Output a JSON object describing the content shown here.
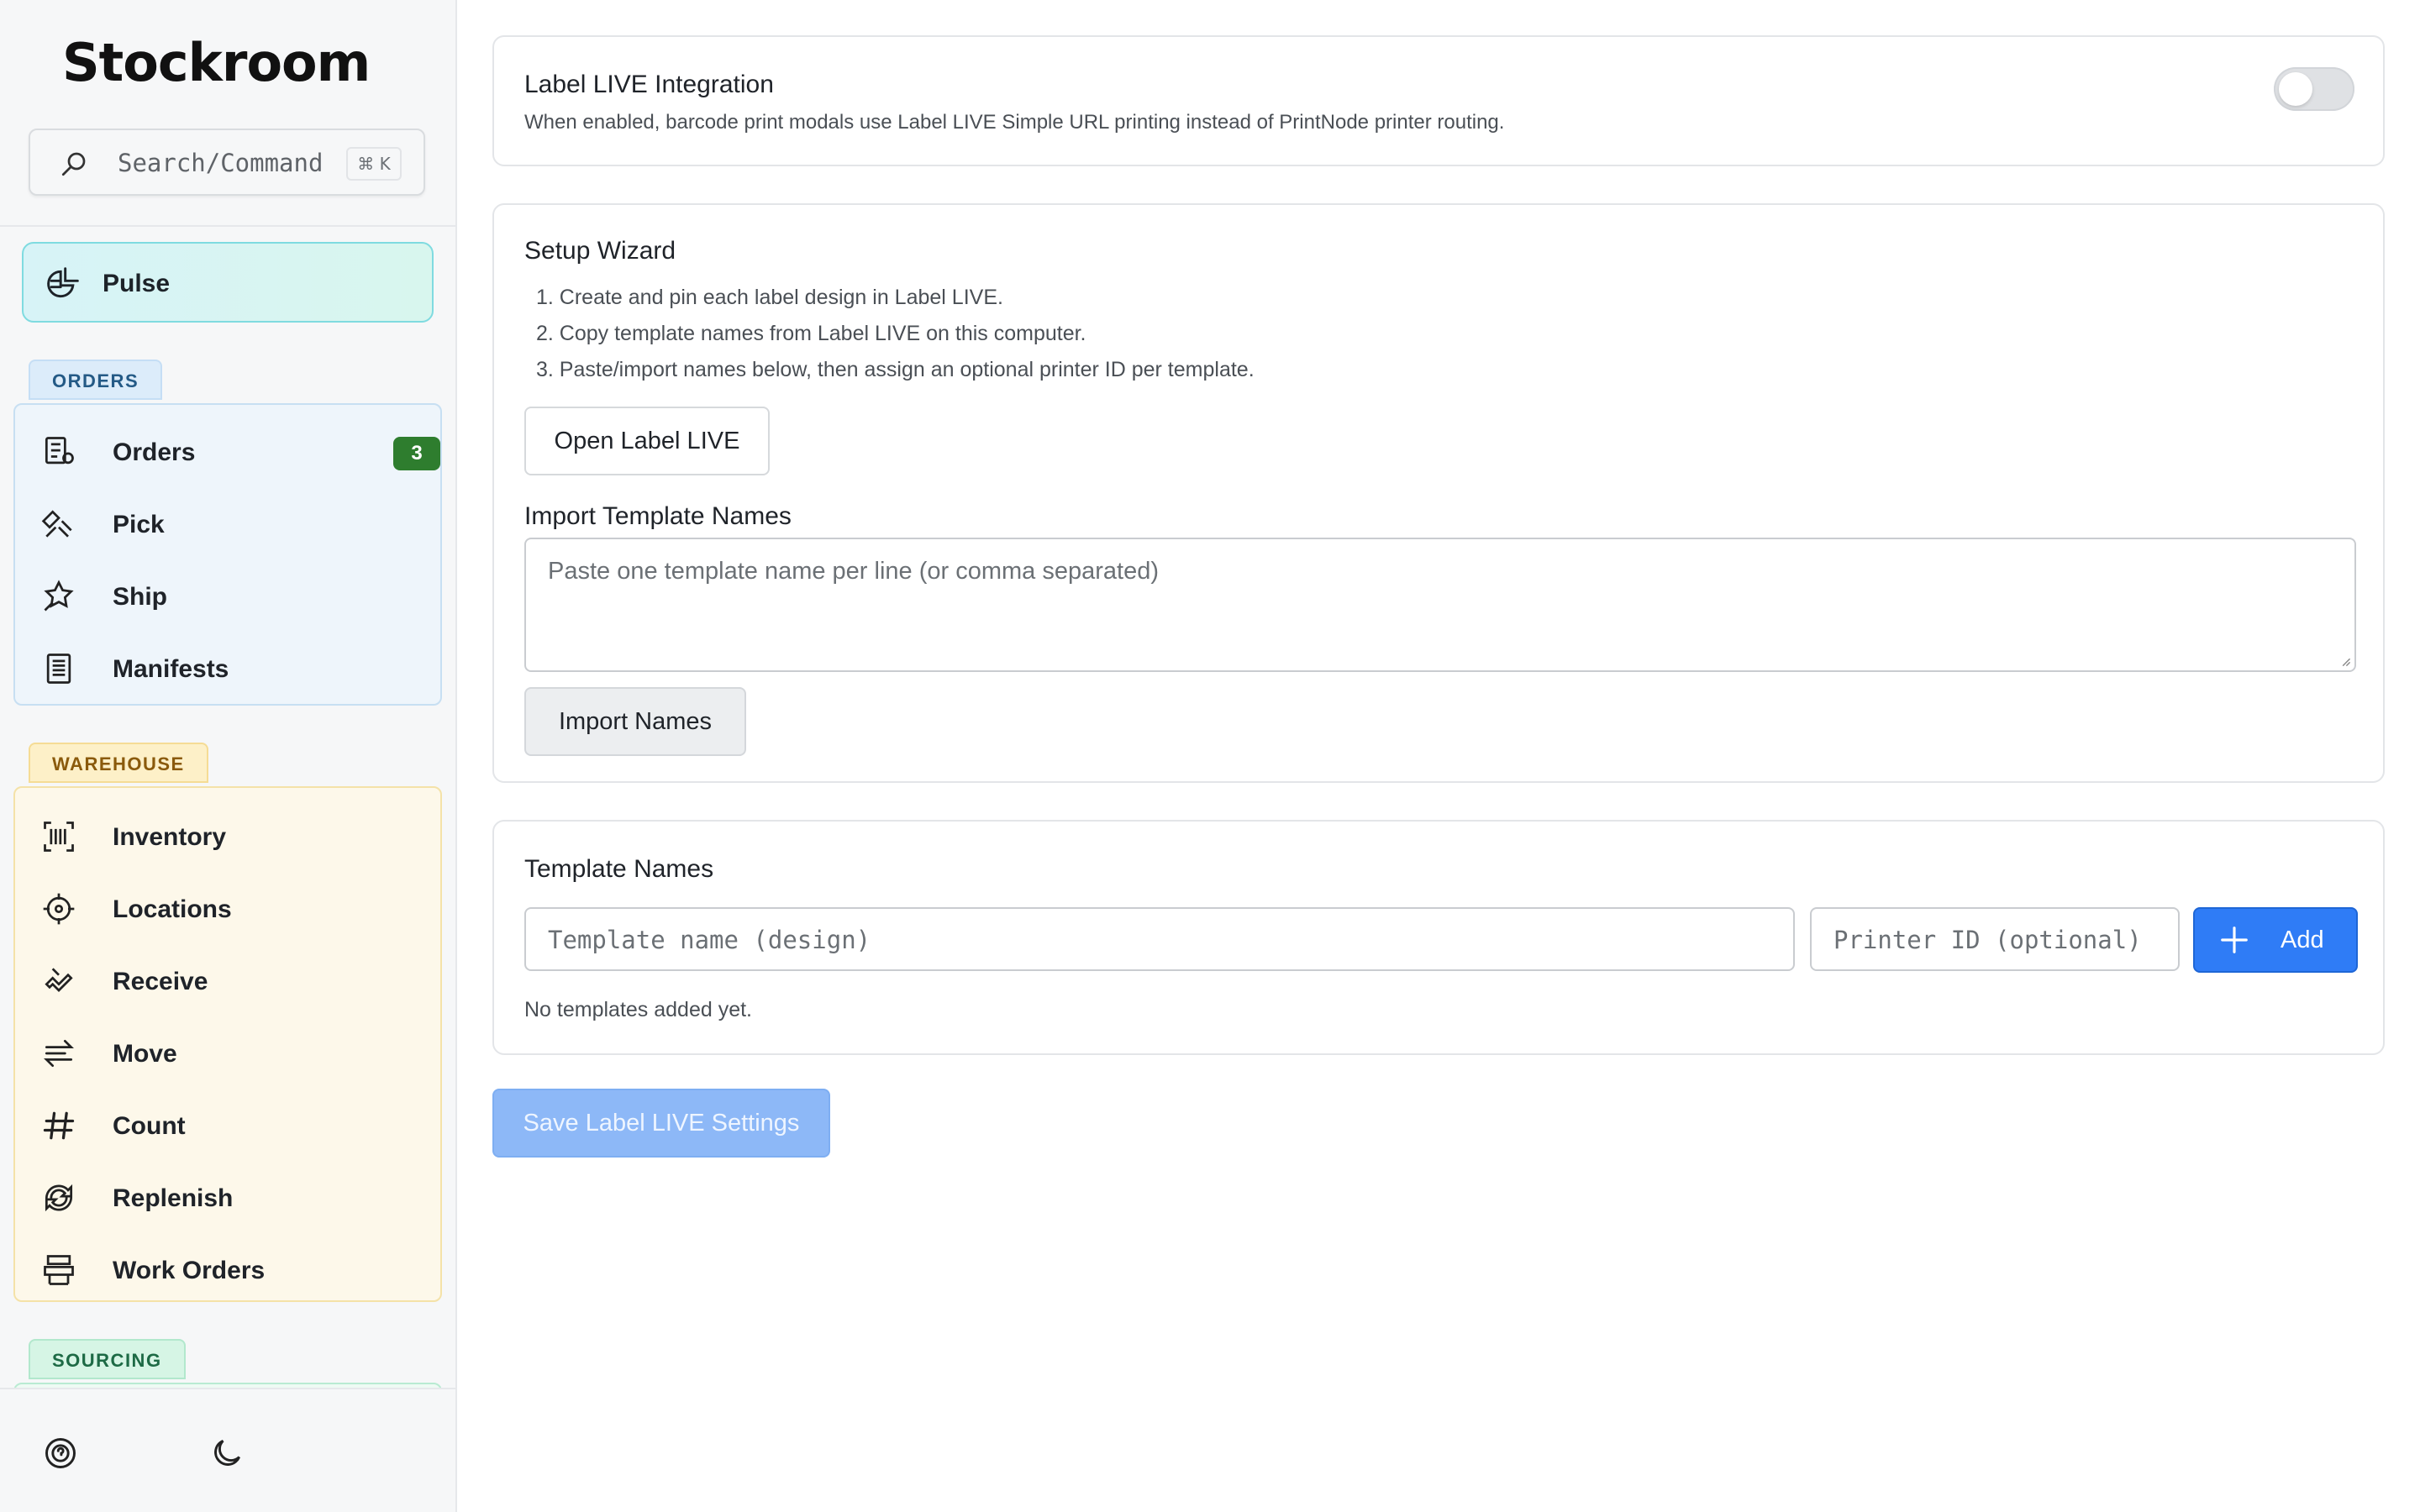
{
  "app": {
    "name": "Stockroom"
  },
  "search": {
    "placeholder": "Search/Command",
    "shortcut": "⌘ K"
  },
  "sidebar": {
    "pulse_label": "Pulse",
    "orders_group": {
      "label": "ORDERS",
      "items": [
        {
          "label": "Orders",
          "badge": "3",
          "icon": "orders-icon"
        },
        {
          "label": "Pick",
          "icon": "pick-icon"
        },
        {
          "label": "Ship",
          "icon": "ship-icon"
        },
        {
          "label": "Manifests",
          "icon": "manifest-icon"
        }
      ]
    },
    "warehouse_group": {
      "label": "WAREHOUSE",
      "items": [
        {
          "label": "Inventory",
          "icon": "barcode-scan-icon"
        },
        {
          "label": "Locations",
          "icon": "crosshair-icon"
        },
        {
          "label": "Receive",
          "icon": "receive-icon"
        },
        {
          "label": "Move",
          "icon": "move-arrows-icon"
        },
        {
          "label": "Count",
          "icon": "hash-icon"
        },
        {
          "label": "Replenish",
          "icon": "replenish-icon"
        },
        {
          "label": "Work Orders",
          "icon": "work-orders-icon"
        }
      ]
    },
    "sourcing_group": {
      "label": "SOURCING"
    }
  },
  "integration": {
    "title": "Label LIVE Integration",
    "description": "When enabled, barcode print modals use Label LIVE Simple URL printing instead of PrintNode printer routing.",
    "enabled": false
  },
  "wizard": {
    "title": "Setup Wizard",
    "steps": [
      "1. Create and pin each label design in Label LIVE.",
      "2. Copy template names from Label LIVE on this computer.",
      "3. Paste/import names below, then assign an optional printer ID per template."
    ],
    "open_button": "Open Label LIVE",
    "import_title": "Import Template Names",
    "import_placeholder": "Paste one template name per line (or comma separated)",
    "import_button": "Import Names"
  },
  "templates": {
    "title": "Template Names",
    "name_placeholder": "Template name (design)",
    "printer_placeholder": "Printer ID (optional)",
    "add_button": "Add",
    "empty_text": "No templates added yet."
  },
  "save_button": "Save Label LIVE Settings",
  "colors": {
    "accent": "#2f7cf6",
    "badge": "#2e7d2e",
    "pulse": "#d7f3f7"
  }
}
